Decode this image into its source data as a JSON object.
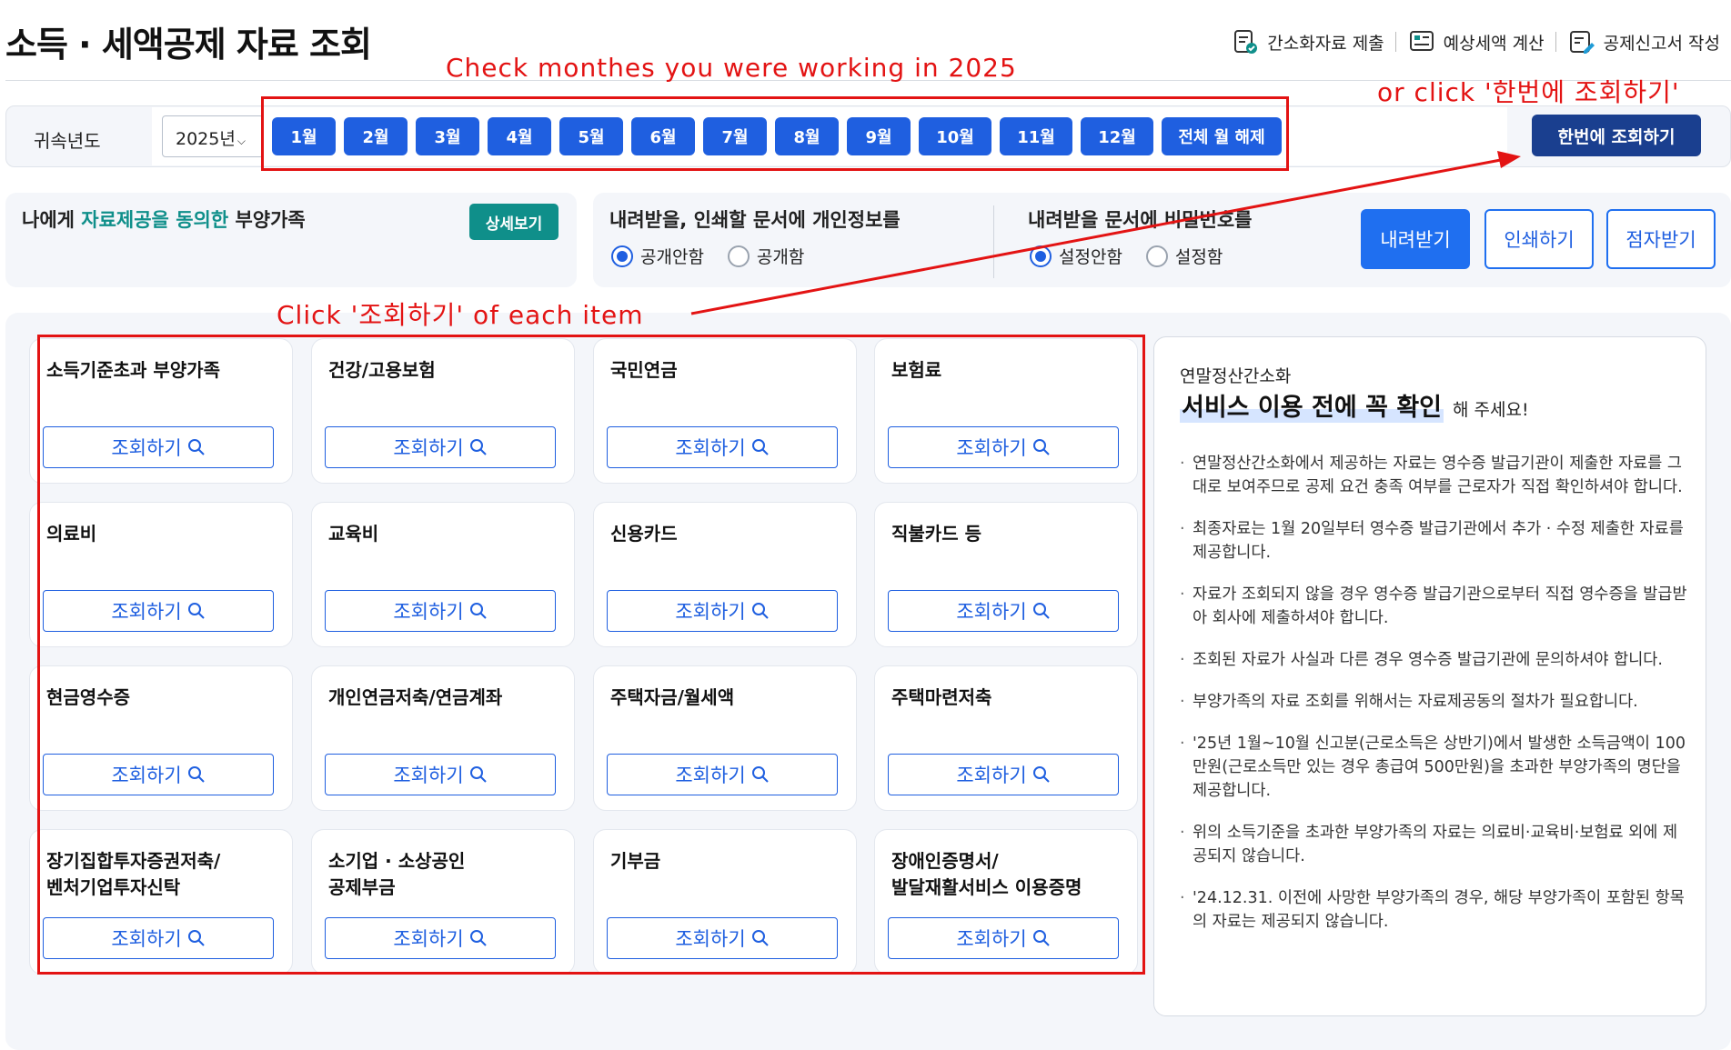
{
  "page": {
    "title": "소득 · 세액공제 자료 조회"
  },
  "top_actions": [
    {
      "label": "간소화자료 제출",
      "icon": "doc-check-icon"
    },
    {
      "label": "예상세액 계산",
      "icon": "calculator-icon"
    },
    {
      "label": "공제신고서 작성",
      "icon": "doc-edit-icon"
    }
  ],
  "year_bar": {
    "label": "귀속년도",
    "selected_year": "2025년",
    "months": [
      "1월",
      "2월",
      "3월",
      "4월",
      "5월",
      "6월",
      "7월",
      "8월",
      "9월",
      "10월",
      "11월",
      "12월"
    ],
    "clear_all": "전체 월 해제",
    "query_all": "한번에 조회하기"
  },
  "consent": {
    "prefix": "나에게 ",
    "highlight": "자료제공을 동의한",
    "suffix": " 부양가족",
    "detail_button": "상세보기"
  },
  "privacy": {
    "personal_info_title": "내려받을, 인쇄할 문서에 개인정보를",
    "personal_info_options": [
      "공개안함",
      "공개함"
    ],
    "personal_info_selected": "공개안함",
    "password_title": "내려받을 문서에 비밀번호를",
    "password_options": [
      "설정안함",
      "설정함"
    ],
    "password_selected": "설정안함",
    "download": "내려받기",
    "print": "인쇄하기",
    "braille": "점자받기"
  },
  "cards": [
    "소득기준초과 부양가족",
    "건강/고용보험",
    "국민연금",
    "보험료",
    "의료비",
    "교육비",
    "신용카드",
    "직불카드 등",
    "현금영수증",
    "개인연금저축/연금계좌",
    "주택자금/월세액",
    "주택마련저축",
    "장기집합투자증권저축/\n벤처기업투자신탁",
    "소기업 · 소상공인\n공제부금",
    "기부금",
    "장애인증명서/\n발달재활서비스 이용증명"
  ],
  "card_button": "조회하기",
  "notice": {
    "subtitle": "연말정산간소화",
    "title": "서비스 이용 전에 꼭 확인",
    "title_tail": "해 주세요!",
    "items": [
      "연말정산간소화에서 제공하는 자료는 영수증 발급기관이 제출한 자료를 그대로 보여주므로 공제 요건 충족 여부를 근로자가 직접 확인하셔야 합니다.",
      "최종자료는 1월 20일부터 영수증 발급기관에서 추가 · 수정 제출한 자료를 제공합니다.",
      "자료가 조회되지 않을 경우 영수증 발급기관으로부터 직접 영수증을 발급받아 회사에 제출하셔야 합니다.",
      "조회된 자료가 사실과 다른 경우 영수증 발급기관에 문의하셔야 합니다.",
      "부양가족의 자료 조회를 위해서는 자료제공동의 절차가 필요합니다.",
      "'25년 1월~10월 신고분(근로소득은 상반기)에서 발생한 소득금액이 100만원(근로소득만 있는 경우 총급여 500만원)을 초과한 부양가족의 명단을 제공합니다.",
      "위의 소득기준을 초과한 부양가족의 자료는 의료비·교육비·보험료 외에 제공되지 않습니다.",
      "'24.12.31. 이전에 사망한 부양가족의 경우, 해당 부양가족이 포함된 항목의 자료는 제공되지 않습니다."
    ]
  },
  "annotations": {
    "months_hint": "Check monthes you were working in 2025",
    "once_hint": "or click '한번에 조회하기'",
    "cards_hint": "Click '조회하기' of each item",
    "color": "#e31313"
  }
}
